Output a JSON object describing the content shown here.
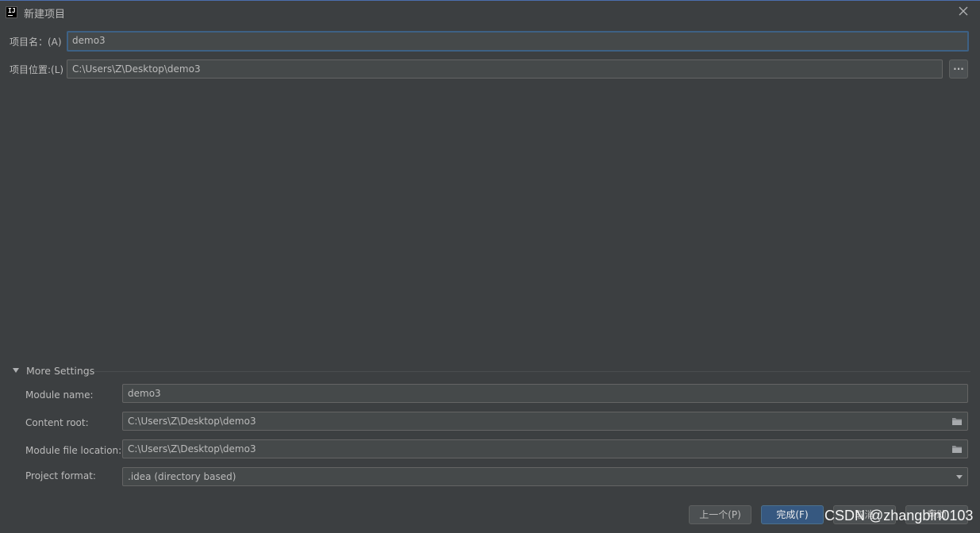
{
  "window": {
    "title": "新建项目",
    "logo_text": "IJ",
    "close_icon": "close-icon"
  },
  "project": {
    "name_label": "项目名：(A)",
    "name_value": "demo3",
    "location_label": "项目位置:(L)",
    "location_value": "C:\\Users\\Z\\Desktop\\demo3",
    "browse_label": "..."
  },
  "more_settings": {
    "title": "More Settings",
    "expanded": true,
    "module_name_label": "Module name:",
    "module_name_value": "demo3",
    "content_root_label": "Content root:",
    "content_root_value": "C:\\Users\\Z\\Desktop\\demo3",
    "module_file_label": "Module file location:",
    "module_file_value": "C:\\Users\\Z\\Desktop\\demo3",
    "project_format_label": "Project format:",
    "project_format_value": ".idea (directory based)"
  },
  "buttons": {
    "previous": "上一个(P)",
    "finish": "完成(F)",
    "cancel": "取消",
    "help": "帮助"
  },
  "watermark": "CSDN @zhangbin0103",
  "colors": {
    "background": "#3c3f41",
    "field": "#45494a",
    "focus_border": "#3d6185",
    "primary_button": "#365880"
  }
}
